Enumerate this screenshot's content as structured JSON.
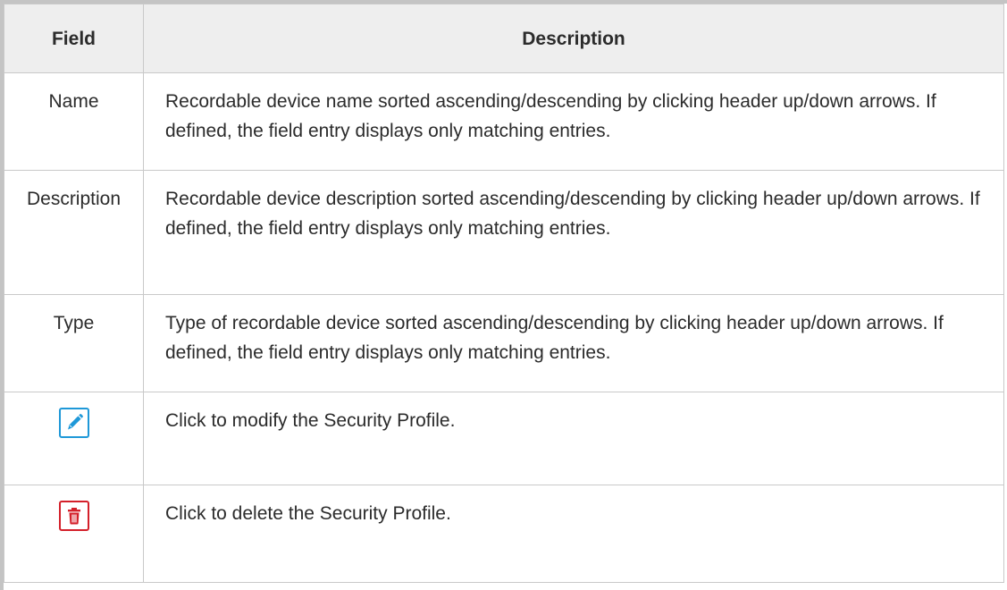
{
  "table": {
    "headers": {
      "field": "Field",
      "description": "Description"
    },
    "rows": [
      {
        "field": "Name",
        "description": "Recordable device name sorted ascending/descending by clicking header up/down arrows. If defined, the field entry displays only matching entries."
      },
      {
        "field": "Description",
        "description": "Recordable device description sorted ascending/descending by clicking header up/down arrows. If defined, the field entry displays only matching entries."
      },
      {
        "field": "Type",
        "description": "Type of recordable device sorted ascending/descending by clicking header up/down arrows. If defined, the field entry displays only matching entries."
      },
      {
        "field_icon": "pencil-edit-icon",
        "description": "Click to modify the Security Profile."
      },
      {
        "field_icon": "trash-delete-icon",
        "description": "Click to delete the Security Profile."
      }
    ]
  },
  "colors": {
    "edit_icon": "#1e98d8",
    "delete_icon": "#d4202a",
    "header_bg": "#eeeeee",
    "border": "#c9c9c9"
  }
}
